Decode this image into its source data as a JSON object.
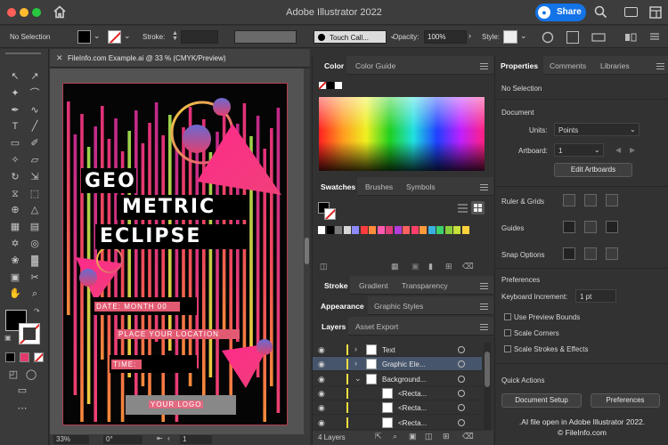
{
  "window": {
    "title": "Adobe Illustrator 2022",
    "share_label": "Share"
  },
  "control_bar": {
    "selection": "No Selection",
    "stroke_label": "Stroke:",
    "brush_value": "Touch Call...",
    "opacity_label": "Opacity:",
    "opacity_value": "100%",
    "style_label": "Style:"
  },
  "document": {
    "tab_title": "FileInfo.com Example.ai @ 33 % (CMYK/Preview)",
    "zoom": "33%",
    "rotation": "0°",
    "artboard_number": "1"
  },
  "artwork": {
    "headline_1": "GEO",
    "headline_2": "METRIC",
    "headline_3": "ECLIPSE",
    "date_line": "DATE: MONTH 00",
    "place_line": "PLACE YOUR LOCATION",
    "time_line": "TIME:",
    "logo_line": "YOUR LOGO"
  },
  "color_panel": {
    "tabs": [
      "Color",
      "Color Guide"
    ]
  },
  "swatches_panel": {
    "tabs": [
      "Swatches",
      "Brushes",
      "Symbols"
    ],
    "colors": [
      "#ffffff",
      "#000000",
      "#7a7a7a",
      "#d6d6d6",
      "#8c8cff",
      "#ff3b3b",
      "#ff8c3b",
      "#ff5ab0",
      "#e03c78",
      "#b43cdc",
      "#ff6060",
      "#ff3f6a",
      "#ff9a3b",
      "#3ab0e0",
      "#3cd26a",
      "#8acd3c",
      "#c8e03c",
      "#ffd23b"
    ]
  },
  "stroke_panel": {
    "tabs": [
      "Stroke",
      "Gradient",
      "Transparency"
    ]
  },
  "appearance_panel": {
    "tabs": [
      "Appearance",
      "Graphic Styles"
    ]
  },
  "layers_panel": {
    "tabs": [
      "Layers",
      "Asset Export"
    ],
    "rows": [
      {
        "name": "Text",
        "indent": 0,
        "expanded": false
      },
      {
        "name": "Graphic Ele...",
        "indent": 0,
        "expanded": false
      },
      {
        "name": "Background...",
        "indent": 0,
        "expanded": true
      },
      {
        "name": "<Recta...",
        "indent": 1,
        "expanded": false
      },
      {
        "name": "<Recta...",
        "indent": 1,
        "expanded": false
      },
      {
        "name": "<Recta...",
        "indent": 1,
        "expanded": false
      }
    ],
    "count_label": "4 Layers"
  },
  "properties_panel": {
    "tabs": [
      "Properties",
      "Comments",
      "Libraries"
    ],
    "selection": "No Selection",
    "document_section": "Document",
    "units_label": "Units:",
    "units_value": "Points",
    "artboard_label": "Artboard:",
    "artboard_value": "1",
    "edit_artboards": "Edit Artboards",
    "ruler_grids": "Ruler & Grids",
    "guides": "Guides",
    "snap_options": "Snap Options",
    "preferences_section": "Preferences",
    "keyboard_increment_label": "Keyboard Increment:",
    "keyboard_increment_value": "1 pt",
    "use_preview_bounds": "Use Preview Bounds",
    "scale_corners": "Scale Corners",
    "scale_strokes": "Scale Strokes & Effects",
    "quick_actions": "Quick Actions",
    "document_setup": "Document Setup",
    "preferences_button": "Preferences"
  },
  "watermark": {
    "line1": ".AI file open in Adobe Illustrator 2022.",
    "line2": "© FileInfo.com"
  }
}
